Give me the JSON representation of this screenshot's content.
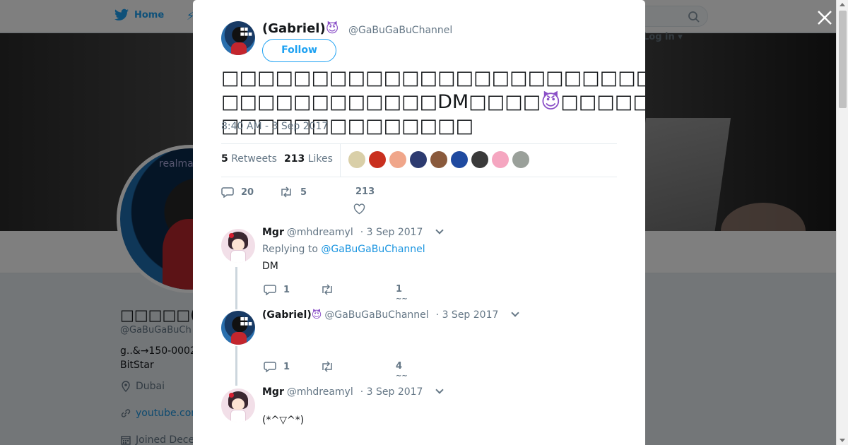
{
  "nav": {
    "home_label": "Home",
    "login_label": "Log in"
  },
  "profile": {
    "name": "□□□□□(Ga",
    "handle": "@GaBuGaBuCh",
    "bio_line1": "g..&→150-0002",
    "bio_line2": "BitStar",
    "location": "Dubai",
    "website": "youtube.con",
    "joined": "Joined Dece"
  },
  "tweet": {
    "author_name": "(Gabriel)",
    "author_emoji": "😈",
    "author_handle": "@GaBuGaBuChannel",
    "follow_label": "Follow",
    "text_line1": "□□□□□□□□□□□□□□□□□□□□□□□□□□",
    "text_line2_a": "□□□□□□□□□□□□DM□□□□",
    "text_emoji": "😈",
    "text_line2_b": "□□□□□□□□□□□□□□□□□□□□□□□□",
    "timestamp": "8:40 AM - 3 Sep 2017",
    "retweets_count": "5",
    "retweets_label": "Retweets",
    "likes_count": "213",
    "likes_label": "Likes",
    "reply_count": "20",
    "retweet_count": "5",
    "like_count": "213",
    "liker_colors": [
      "#d9cfa8",
      "#c9301f",
      "#f0a68a",
      "#2d3b70",
      "#8a5a3c",
      "#1f4aa0",
      "#3a3a3a",
      "#f5a6c0",
      "#9aa09a"
    ]
  },
  "replies": [
    {
      "name": "Mgr",
      "handle": "@mhdreamyl",
      "date": "· 3 Sep 2017",
      "replying_prefix": "Replying to",
      "replying_to": "@GaBuGaBuChannel",
      "text": "DM",
      "reply_count": "1",
      "like_count": "1"
    },
    {
      "name": "(Gabriel)",
      "emoji": "😈",
      "handle": "@GaBuGaBuChannel",
      "date": "· 3 Sep 2017",
      "text": "",
      "reply_count": "1",
      "like_count": "4"
    },
    {
      "name": "Mgr",
      "handle": "@mhdreamyl",
      "date": "· 3 Sep 2017",
      "text": "(*^▽^*)"
    }
  ]
}
